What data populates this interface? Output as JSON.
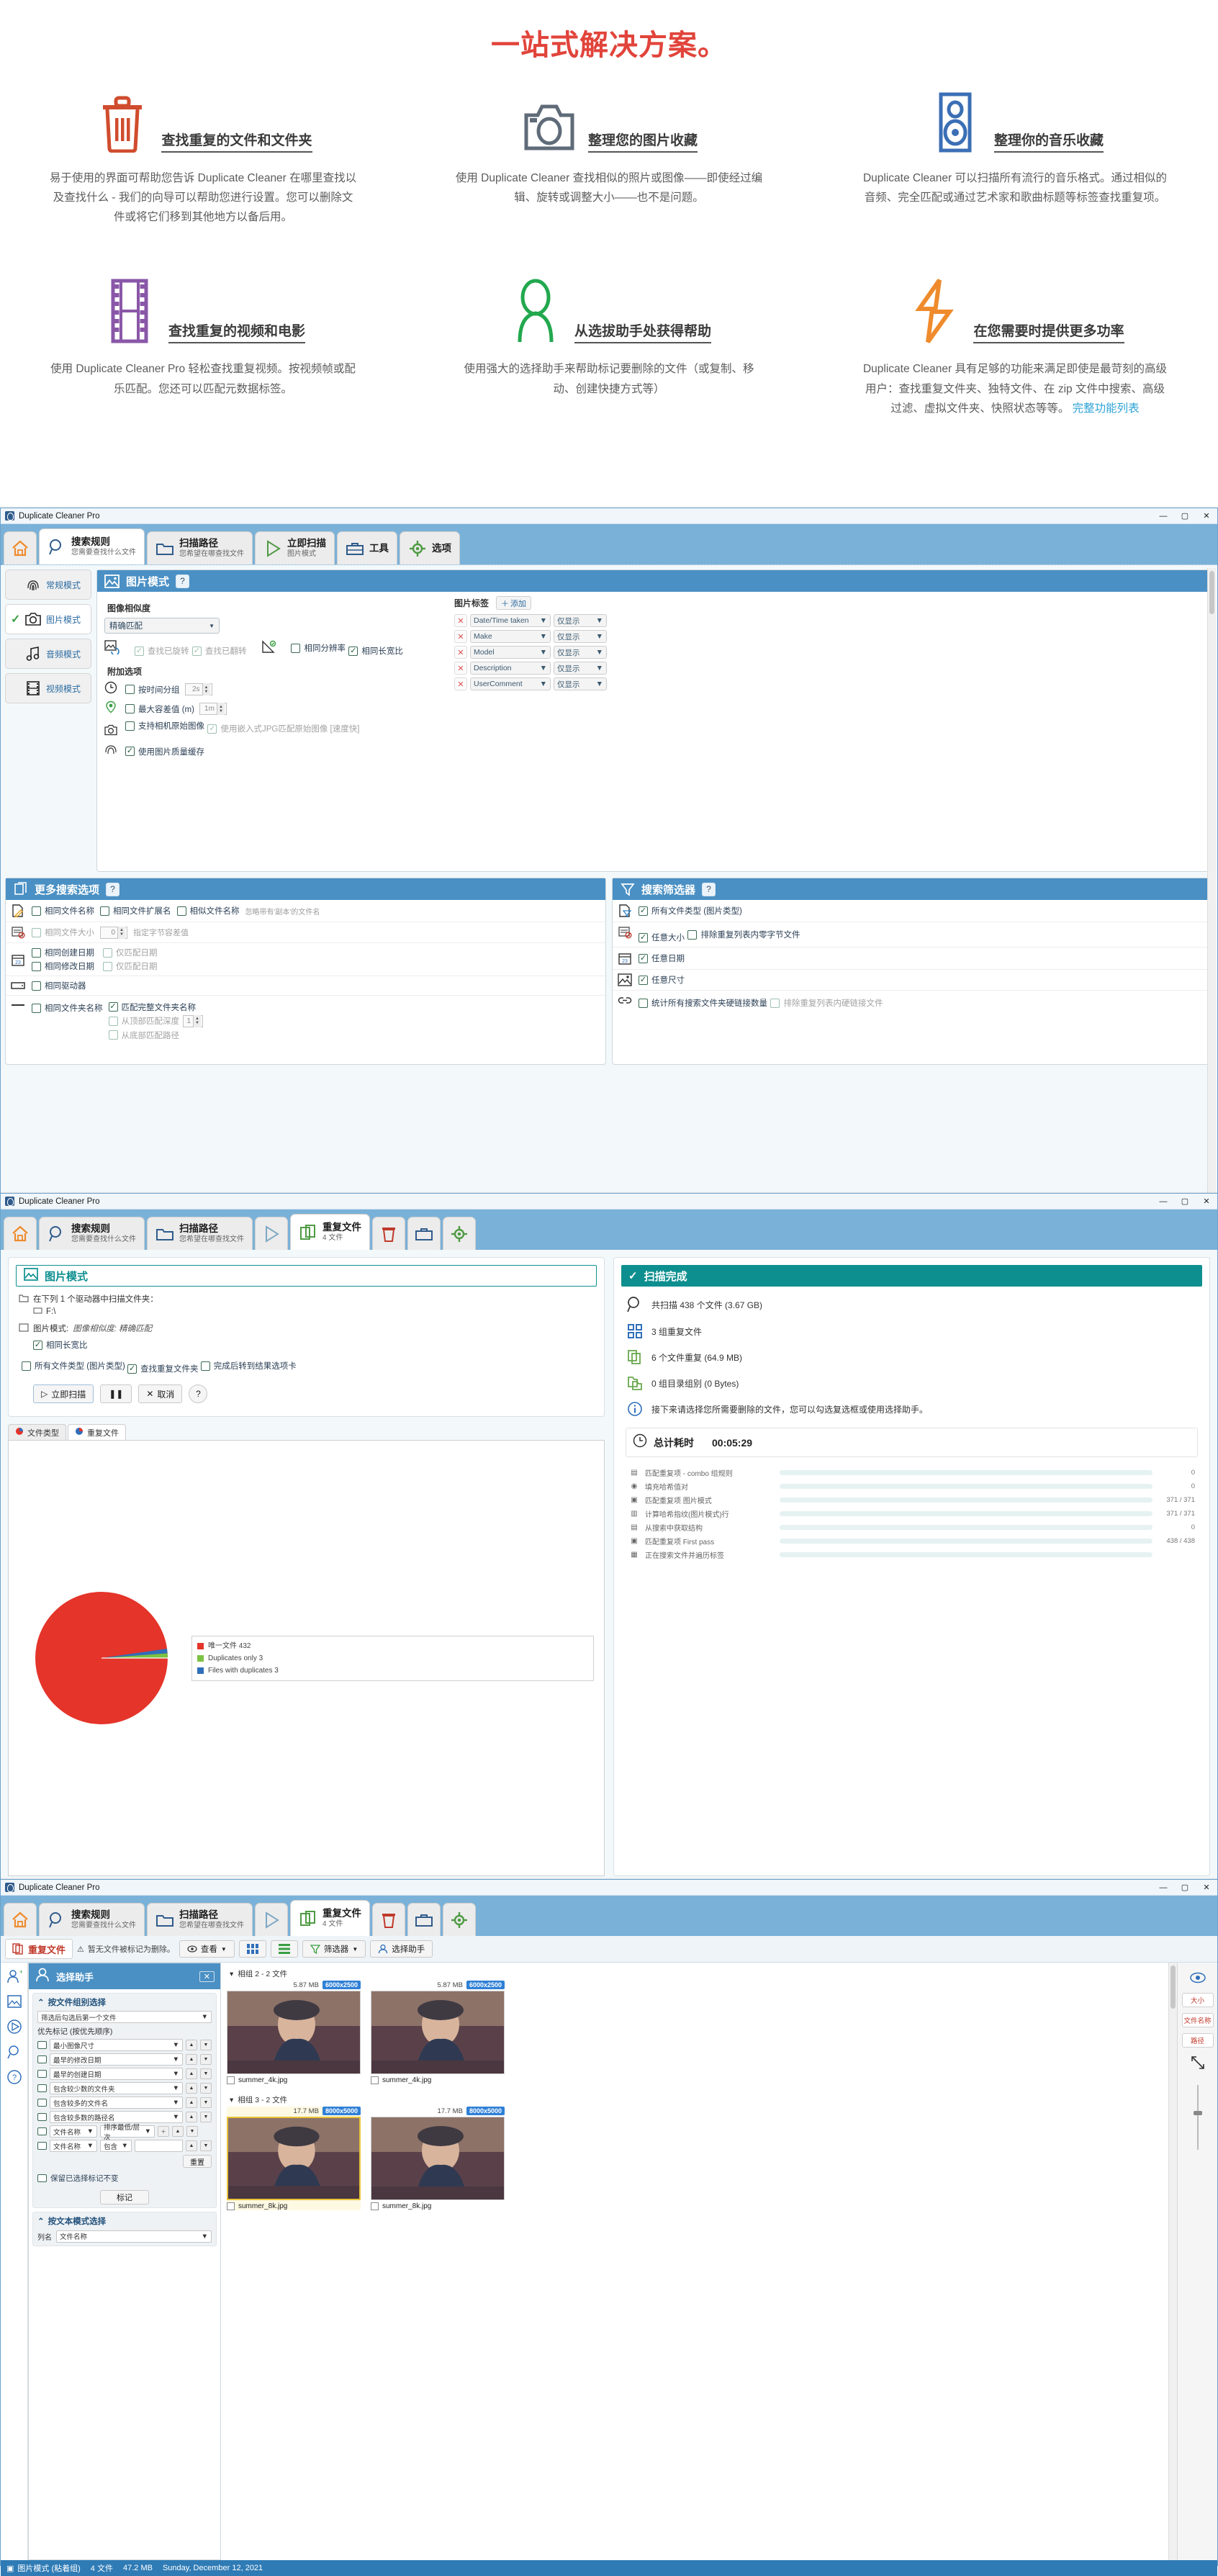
{
  "promo": {
    "title": "一站式解决方案。",
    "features": [
      {
        "icon": "trash-icon",
        "name": "查找重复的文件和文件夹",
        "desc": "易于使用的界面可帮助您告诉 Duplicate Cleaner 在哪里查找以及查找什么 - 我们的向导可以帮助您进行设置。您可以删除文件或将它们移到其他地方以备后用。",
        "color": "#d04c2e"
      },
      {
        "icon": "camera-icon",
        "name": "整理您的图片收藏",
        "desc": "使用 Duplicate Cleaner 查找相似的照片或图像——即使经过编辑、旋转或调整大小——也不是问题。",
        "color": "#5f6b78"
      },
      {
        "icon": "speaker-icon",
        "name": "整理你的音乐收藏",
        "desc": "Duplicate Cleaner 可以扫描所有流行的音乐格式。通过相似的音频、完全匹配或通过艺术家和歌曲标题等标签查找重复项。",
        "color": "#3b6fb5"
      },
      {
        "icon": "film-icon",
        "name": "查找重复的视频和电影",
        "desc": "使用 Duplicate Cleaner Pro 轻松查找重复视频。按视频帧或配乐匹配。您还可以匹配元数据标签。",
        "color": "#8a57a8"
      },
      {
        "icon": "person-icon",
        "name": "从选拔助手处获得帮助",
        "desc": "使用强大的选择助手来帮助标记要删除的文件（或复制、移动、创建快捷方式等）",
        "color": "#22a84e"
      },
      {
        "icon": "bolt-icon",
        "name": "在您需要时提供更多功率",
        "desc_a": "Duplicate Cleaner 具有足够的功能来满足即使是最苛刻的高级用户：查找重复文件夹、独特文件、在 zip 文件中搜索、高级过滤、虚拟文件夹、快照状态等等。",
        "desc_link": "完整功能列表",
        "color": "#ef8b2c"
      }
    ]
  },
  "window1": {
    "title": "Duplicate Cleaner Pro",
    "controls": {
      "min": "—",
      "max": "▢",
      "close": "✕"
    },
    "ribbon": [
      {
        "icon": "home-icon",
        "t1": "",
        "t2": "",
        "active": false,
        "iconOnly": true
      },
      {
        "icon": "search-icon",
        "t1": "搜索规则",
        "t2": "您需要查找什么文件",
        "active": true
      },
      {
        "icon": "folder-icon",
        "t1": "扫描路径",
        "t2": "您希望在哪查找文件",
        "active": false
      },
      {
        "icon": "play-icon",
        "t1": "立即扫描",
        "t2": "图片模式",
        "active": false
      },
      {
        "icon": "toolbox-icon",
        "t1": "工具",
        "t2": "",
        "active": false
      },
      {
        "icon": "gear-icon",
        "t1": "选项",
        "t2": "",
        "active": false
      }
    ],
    "modes": [
      {
        "label": "常规模式",
        "icon": "fingerprint-icon",
        "selected": false
      },
      {
        "label": "图片模式",
        "icon": "camera-icon",
        "selected": true
      },
      {
        "label": "音频模式",
        "icon": "music-icon",
        "selected": false
      },
      {
        "label": "视频模式",
        "icon": "film-icon",
        "selected": false
      }
    ],
    "imagePanel": {
      "header": "图片模式",
      "help": "?",
      "similarityLabel": "图像相似度",
      "similarityValue": "精确匹配",
      "checks": [
        {
          "label": "查找已旋转",
          "checked": true,
          "disabled": true
        },
        {
          "label": "查找已翻转",
          "checked": true,
          "disabled": true
        },
        {
          "label": "相同分辨率",
          "checked": false,
          "disabled": false
        },
        {
          "label": "相同长宽比",
          "checked": true,
          "disabled": false
        }
      ],
      "extraLabel": "附加选项",
      "extras": [
        {
          "icon": "clock-icon",
          "label": "按时间分组",
          "checked": false,
          "spin": "2s"
        },
        {
          "icon": "pin-icon",
          "label": "最大容差值 (m)",
          "checked": false,
          "spin": "1m"
        },
        {
          "icon": "camera-icon",
          "label": "支持相机原始图像",
          "checked": false,
          "spin": ""
        },
        {
          "icon": "",
          "label": "使用嵌入式JPG匹配原始图像 [速度快]",
          "checked": true,
          "disabled": true,
          "spin": ""
        },
        {
          "icon": "fingerprint-icon",
          "label": "使用图片质量缓存",
          "checked": true,
          "spin": ""
        }
      ],
      "tagsLabel": "图片标签",
      "addLabel": "添加",
      "tags": [
        {
          "name": "Date/Time taken",
          "mode": "仅显示"
        },
        {
          "name": "Make",
          "mode": "仅显示"
        },
        {
          "name": "Model",
          "mode": "仅显示"
        },
        {
          "name": "Description",
          "mode": "仅显示"
        },
        {
          "name": "UserComment",
          "mode": "仅显示"
        }
      ]
    },
    "morePanel": {
      "header": "更多搜索选项",
      "help": "?",
      "rows": [
        {
          "icon": "file-edit-icon",
          "items": [
            {
              "label": "相同文件名称",
              "checked": false
            },
            {
              "label": "相同文件扩展名",
              "checked": false
            },
            {
              "label": "相似文件名称",
              "checked": false
            }
          ],
          "note": "忽略带有'副本'的文件名"
        },
        {
          "icon": "file-size-icon",
          "items": [
            {
              "label": "相同文件大小",
              "checked": false,
              "disabled": true
            }
          ],
          "spin": "0",
          "note": "指定字节容差值"
        },
        {
          "icon": "calendar-icon",
          "items": [
            {
              "label": "相同创建日期",
              "checked": false
            },
            {
              "label": "仅匹配日期",
              "checked": false,
              "disabled": true
            },
            {
              "label": "相同修改日期",
              "checked": false
            },
            {
              "label": "仅匹配日期",
              "checked": false,
              "disabled": true
            }
          ]
        },
        {
          "icon": "drive-icon",
          "items": [
            {
              "label": "相同驱动器",
              "checked": false
            }
          ]
        },
        {
          "icon": "folder-line-icon",
          "items": [
            {
              "label": "相同文件夹名称",
              "checked": false
            },
            {
              "label": "匹配完整文件夹名称",
              "checked": true
            },
            {
              "label": "从顶部匹配深度",
              "checked": false,
              "spin": "1"
            },
            {
              "label": "从底部匹配路径",
              "checked": false
            }
          ]
        }
      ]
    },
    "filterPanel": {
      "header": "搜索筛选器",
      "help": "?",
      "rows": [
        {
          "icon": "file-filter-icon",
          "items": [
            {
              "label": "所有文件类型 (图片类型)",
              "checked": true
            }
          ]
        },
        {
          "icon": "file-size-icon",
          "items": [
            {
              "label": "任意大小",
              "checked": true
            },
            {
              "label": "排除重复列表内零字节文件",
              "checked": false
            }
          ]
        },
        {
          "icon": "calendar-icon",
          "items": [
            {
              "label": "任意日期",
              "checked": true
            }
          ]
        },
        {
          "icon": "image-icon",
          "items": [
            {
              "label": "任意尺寸",
              "checked": true
            }
          ]
        },
        {
          "icon": "link-icon",
          "items": [
            {
              "label": "统计所有搜索文件夹硬链接数量",
              "checked": false
            },
            {
              "label": "排除重复列表内硬链接文件",
              "checked": false,
              "disabled": true
            }
          ]
        }
      ]
    }
  },
  "window2": {
    "title": "Duplicate Cleaner Pro",
    "ribbon": [
      {
        "icon": "home-icon",
        "t1": "",
        "t2": "",
        "iconOnly": true
      },
      {
        "icon": "search-icon",
        "t1": "搜索规则",
        "t2": "您需要查找什么文件"
      },
      {
        "icon": "folder-icon",
        "t1": "扫描路径",
        "t2": "您希望在哪查找文件"
      },
      {
        "icon": "play-icon",
        "t1": "",
        "t2": "",
        "iconOnly": true
      },
      {
        "icon": "files-icon",
        "t1": "重复文件",
        "t2": "4 文件",
        "active": true
      },
      {
        "icon": "delete-icon",
        "t1": "",
        "t2": "",
        "iconOnly": true
      },
      {
        "icon": "toolbox-icon",
        "t1": "",
        "t2": "",
        "iconOnly": true
      },
      {
        "icon": "gear-icon",
        "t1": "",
        "t2": "",
        "iconOnly": true
      }
    ],
    "leftCard": {
      "header": "图片模式",
      "pathLabel": "在下列 1 个驱动器中扫描文件夹：",
      "pathValue": "F:\\",
      "modeLabel": "图片模式:",
      "modeValue": "图像相似度: 精确匹配",
      "opts": [
        {
          "label": "相同长宽比",
          "checked": true
        },
        {
          "label": "所有文件类型 (图片类型)",
          "checked": false
        },
        {
          "label": "查找重复文件夹",
          "checked": true
        },
        {
          "label": "完成后转到结果选项卡",
          "checked": false
        }
      ],
      "buttons": {
        "scan": "立即扫描",
        "pause": "❚❚",
        "cancel": "取消",
        "help": "?"
      }
    },
    "chartTabs": [
      {
        "label": "文件类型",
        "icon": "pie-icon",
        "on": false
      },
      {
        "label": "重复文件",
        "icon": "pie-icon",
        "on": true
      }
    ],
    "rightCard": {
      "header": "扫描完成",
      "stats": [
        {
          "icon": "search-icon",
          "text": "共扫描 438 个文件 (3.67 GB)"
        },
        {
          "icon": "grid-icon",
          "text": "3 组重复文件"
        },
        {
          "icon": "files-green-icon",
          "text": "6 个文件重复 (64.9 MB)"
        },
        {
          "icon": "folder-green-icon",
          "text": "0 组目录组别 (0 Bytes)"
        },
        {
          "icon": "info-icon",
          "text": "接下来请选择您所需要删除的文件，您可以勾选复选框或使用选择助手。"
        }
      ],
      "timeHeader": "总计耗时",
      "timeValue": "00:05:29",
      "progress": [
        {
          "icon": "folder-icon",
          "label": "匹配重复项 - combo 组规则",
          "pct": 100,
          "val": "0"
        },
        {
          "icon": "fingerprint-icon",
          "label": "填充哈希值对",
          "pct": 100,
          "val": "0"
        },
        {
          "icon": "image-icon",
          "label": "匹配重复项 图片模式",
          "pct": 100,
          "val": "371 / 371"
        },
        {
          "icon": "calc-icon",
          "label": "计算哈希指纹(图片模式)行",
          "pct": 100,
          "val": "371 / 371"
        },
        {
          "icon": "folder-icon",
          "label": "从搜索中获取结构",
          "pct": 100,
          "val": "0"
        },
        {
          "icon": "image-icon",
          "label": "匹配重复项 First pass",
          "pct": 100,
          "val": "438 / 438"
        },
        {
          "icon": "files-icon",
          "label": "正在搜索文件并遍历标签",
          "pct": 100,
          "val": ""
        }
      ]
    },
    "chart_data": {
      "type": "pie",
      "title": "重复文件",
      "categories": [
        "唯一文件",
        "Duplicates only",
        "Files with duplicates"
      ],
      "values": [
        432,
        3,
        3
      ],
      "labels": [
        "唯一文件  432",
        "Duplicates only  3",
        "Files with duplicates  3"
      ],
      "colors": [
        "#e5342a",
        "#7cc242",
        "#2f6fba"
      ],
      "legend_position": "right",
      "total": 438
    }
  },
  "window3": {
    "title": "Duplicate Cleaner Pro",
    "ribbon": [
      {
        "icon": "home-icon",
        "iconOnly": true
      },
      {
        "icon": "search-icon",
        "t1": "搜索规则",
        "t2": "您需要查找什么文件"
      },
      {
        "icon": "folder-icon",
        "t1": "扫描路径",
        "t2": "您希望在哪查找文件"
      },
      {
        "icon": "play-icon",
        "iconOnly": true
      },
      {
        "icon": "files-icon",
        "t1": "重复文件",
        "t2": "4 文件",
        "active": true
      },
      {
        "icon": "delete-icon",
        "iconOnly": true
      },
      {
        "icon": "toolbox-icon",
        "iconOnly": true
      },
      {
        "icon": "gear-icon",
        "iconOnly": true
      }
    ],
    "toolbar": {
      "title": "重复文件",
      "hint": "暂无文件被标记为删除。",
      "view": "查看",
      "filter": "筛选器",
      "assistant": "选择助手"
    },
    "assistant": {
      "title": "选择助手",
      "close": "✕",
      "group1": "按文件组别选择",
      "group1Sub": "筛选后勾选后第一个文件",
      "priorityLabel": "优先标记 (按优先顺序)",
      "rules": [
        {
          "label": "最小图像尺寸"
        },
        {
          "label": "最早的修改日期"
        },
        {
          "label": "最早的创建日期"
        },
        {
          "label": "包含较少数的文件夹"
        },
        {
          "label": "包含较多的文件名"
        },
        {
          "label": "包含较多数的路径名"
        }
      ],
      "extraRules": [
        {
          "a": "文件名称",
          "b": "排序最低/层次"
        },
        {
          "a": "文件名称",
          "b": "包含"
        }
      ],
      "resetLabel": "重置",
      "keepLabel": "保留已选择标记不变",
      "markLabel": "标记",
      "group2": "按文本模式选择",
      "colLabel": "列名",
      "colValue": "文件名称"
    },
    "groups": [
      {
        "title": "相组 2 - 2 文件",
        "files": [
          {
            "size": "5.87 MB",
            "dims": "6000x2500",
            "name": "summer_4k.jpg",
            "selected": false,
            "checked": false
          },
          {
            "size": "5.87 MB",
            "dims": "6000x2500",
            "name": "summer_4k.jpg",
            "selected": false,
            "checked": false
          }
        ]
      },
      {
        "title": "相组 3 - 2 文件",
        "files": [
          {
            "size": "17.7 MB",
            "dims": "8000x5000",
            "name": "summer_8k.jpg",
            "selected": true,
            "checked": false
          },
          {
            "size": "17.7 MB",
            "dims": "8000x5000",
            "name": "summer_8k.jpg",
            "selected": false,
            "checked": false
          }
        ]
      }
    ],
    "rightRail": [
      {
        "icon": "eye-icon",
        "label": ""
      },
      {
        "label": "大小"
      },
      {
        "label": "文件名称"
      },
      {
        "label": "路径"
      },
      {
        "icon": "expand-icon",
        "label": ""
      }
    ],
    "statusbar": {
      "mode": "图片模式 (粘着组)",
      "files": "4 文件",
      "size": "47.2 MB",
      "date": "Sunday, December 12, 2021"
    }
  }
}
